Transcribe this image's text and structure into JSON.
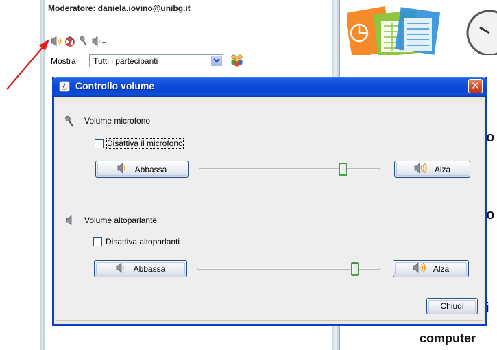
{
  "background": {
    "moderator_text": "Moderatore: daniela.iovino@unibg.it",
    "toolbar_icons": [
      "speaker-volume-icon",
      "microphone-muted-icon",
      "microphone-icon",
      "speaker-dropdown-icon"
    ],
    "show_label": "Mostra",
    "participants_filter": "Tutti i partecipanti",
    "slide_text_fragments": [
      "o",
      "o",
      "si",
      "computer"
    ]
  },
  "annotation": {
    "color": "#e31b1b"
  },
  "dialog": {
    "title": "Controllo volume",
    "close_label": "✕",
    "microphone": {
      "section_label": "Volume microfono",
      "mute_label": "Disattiva il microfono",
      "mute_checked": false,
      "decrease_label": "Abbassa",
      "increase_label": "Alza",
      "level": 0.81
    },
    "speaker": {
      "section_label": "Volume altoparlante",
      "mute_label": "Disattiva altoparlanti",
      "mute_checked": false,
      "decrease_label": "Abbassa",
      "increase_label": "Alza",
      "level": 0.88
    },
    "close_button_label": "Chiudi"
  },
  "colors": {
    "title_bar": "#0a45d0",
    "close_button": "#d74a23",
    "slider_thumb_accent": "#33b233",
    "dialog_background": "#eeeeee"
  }
}
